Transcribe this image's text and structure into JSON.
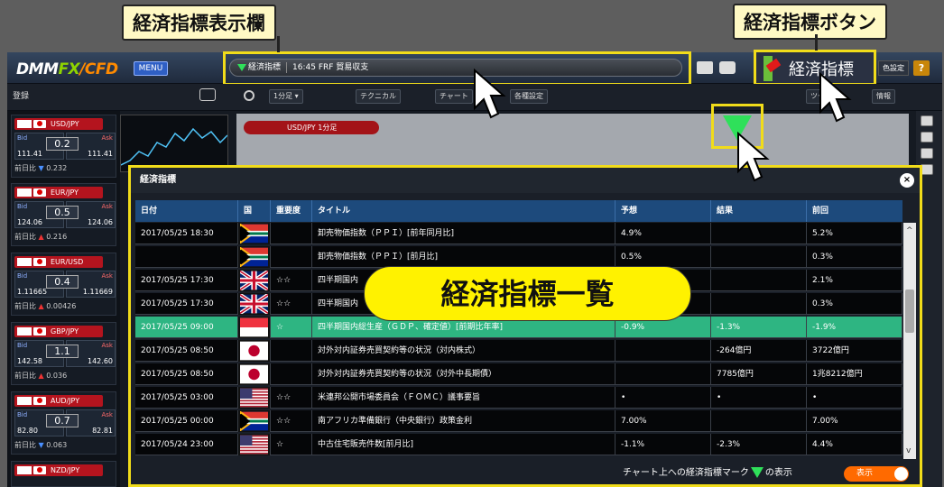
{
  "callouts": {
    "indicator_display": "経済指標表示欄",
    "indicator_button": "経済指標ボタン",
    "indicator_list": "経済指標一覧"
  },
  "header": {
    "logo_dmm": "DMM",
    "logo_fx": "FX",
    "logo_cfd": "/CFD",
    "menu": "MENU",
    "ticker_label": "経済指標",
    "ticker_text": "16:45 FRF 貿易収支",
    "indicator_button_label": "経済指標",
    "settings_label": "色設定",
    "help_label": "?"
  },
  "toolbar": {
    "register": "登録",
    "timeframe": "1分足",
    "technical": "テクニカル",
    "chart": "チャート",
    "settings": "各種設定",
    "tool": "ツール",
    "info": "情報"
  },
  "chart_pair_label": "USD/JPY 1分足",
  "sidebar": {
    "pairs": [
      {
        "name": "USD/JPY",
        "spread": "0.2",
        "bid": "111.41",
        "ask": "111.41",
        "change": "0.232",
        "direction": "down",
        "bid_label": "Bid",
        "ask_label": "Ask",
        "prev_label": "前日比"
      },
      {
        "name": "EUR/JPY",
        "spread": "0.5",
        "bid": "124.06",
        "ask": "124.06",
        "change": "0.216",
        "direction": "up",
        "bid_label": "Bid",
        "ask_label": "Ask",
        "prev_label": "前日比"
      },
      {
        "name": "EUR/USD",
        "spread": "0.4",
        "bid": "1.11665",
        "ask": "1.11669",
        "change": "0.00426",
        "direction": "up",
        "bid_label": "Bid",
        "ask_label": "Ask",
        "prev_label": "前日比"
      },
      {
        "name": "GBP/JPY",
        "spread": "1.1",
        "bid": "142.58",
        "ask": "142.60",
        "change": "0.036",
        "direction": "up",
        "bid_label": "Bid",
        "ask_label": "Ask",
        "prev_label": "前日比"
      },
      {
        "name": "AUD/JPY",
        "spread": "0.7",
        "bid": "82.80",
        "ask": "82.81",
        "change": "0.063",
        "direction": "down",
        "bid_label": "Bid",
        "ask_label": "Ask",
        "prev_label": "前日比"
      },
      {
        "name": "NZD/JPY"
      }
    ]
  },
  "panel": {
    "title": "経済指標",
    "columns": [
      "日付",
      "国",
      "重要度",
      "タイトル",
      "予想",
      "結果",
      "前回"
    ],
    "rows": [
      {
        "date": "2017/05/25 18:30",
        "flag": "za",
        "stars": "",
        "title": "卸売物価指数（ＰＰＩ）[前年同月比]",
        "forecast": "4.9%",
        "result": "",
        "previous": "5.2%",
        "selected": false
      },
      {
        "date": "",
        "flag": "za",
        "stars": "",
        "title": "卸売物価指数（ＰＰＩ）[前月比]",
        "forecast": "0.5%",
        "result": "",
        "previous": "0.3%",
        "selected": false
      },
      {
        "date": "2017/05/25 17:30",
        "flag": "gb",
        "stars": "☆☆",
        "title": "四半期国内",
        "forecast": "",
        "result": "",
        "previous": "2.1%",
        "selected": false
      },
      {
        "date": "2017/05/25 17:30",
        "flag": "gb",
        "stars": "☆☆",
        "title": "四半期国内",
        "forecast": "",
        "result": "",
        "previous": "0.3%",
        "selected": false
      },
      {
        "date": "2017/05/25 09:00",
        "flag": "sg",
        "stars": "☆",
        "title": "四半期国内総生産（ＧＤＰ、確定値）[前期比年率]",
        "forecast": "-0.9%",
        "result": "-1.3%",
        "previous": "-1.9%",
        "selected": true
      },
      {
        "date": "2017/05/25 08:50",
        "flag": "jp",
        "stars": "",
        "title": "対外対内証券売買契約等の状況（対内株式）",
        "forecast": "",
        "result": "-264億円",
        "previous": "3722億円",
        "selected": false
      },
      {
        "date": "2017/05/25 08:50",
        "flag": "jp",
        "stars": "",
        "title": "対外対内証券売買契約等の状況（対外中長期債）",
        "forecast": "",
        "result": "7785億円",
        "previous": "1兆8212億円",
        "selected": false
      },
      {
        "date": "2017/05/25 03:00",
        "flag": "us",
        "stars": "☆☆",
        "title": "米連邦公開市場委員会（ＦＯＭＣ）議事要旨",
        "forecast": "•",
        "result": "•",
        "previous": "•",
        "selected": false
      },
      {
        "date": "2017/05/25 00:00",
        "flag": "za",
        "stars": "☆☆",
        "title": "南アフリカ準備銀行（中央銀行）政策金利",
        "forecast": "7.00%",
        "result": "",
        "previous": "7.00%",
        "selected": false
      },
      {
        "date": "2017/05/24 23:00",
        "flag": "us",
        "stars": "☆",
        "title": "中古住宅販売件数[前月比]",
        "forecast": "-1.1%",
        "result": "-2.3%",
        "previous": "4.4%",
        "selected": false
      }
    ],
    "footer_label_1": "チャート上への経済指標マーク",
    "footer_label_2": "の表示",
    "toggle_label": "表示"
  },
  "colors": {
    "highlight": "#f1dc1a",
    "selected_row": "#2eb582",
    "indicator_mark": "#2fe05a",
    "toggle": "#ff6a00"
  }
}
